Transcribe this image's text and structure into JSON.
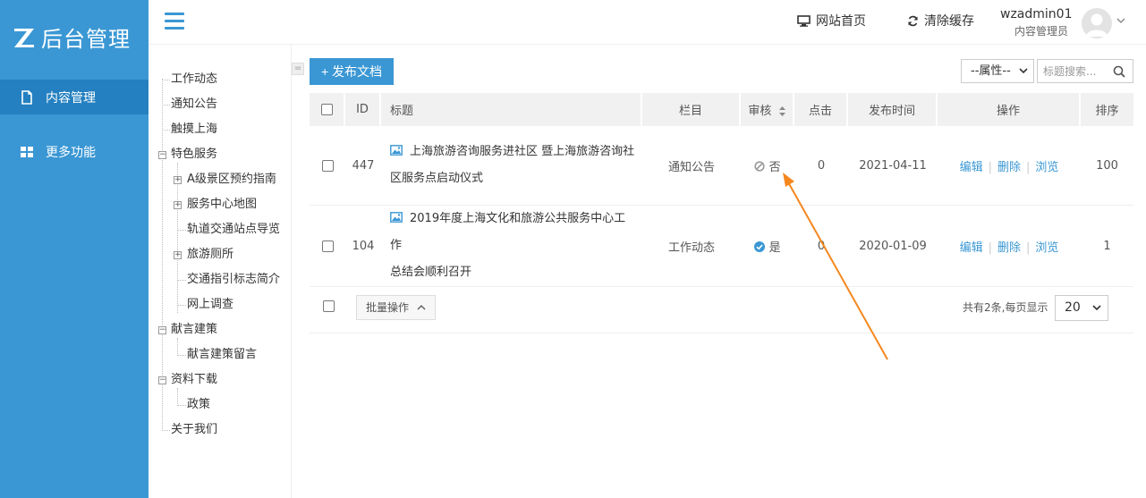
{
  "brand": {
    "logo_text": "后台管理"
  },
  "sidebar": {
    "items": [
      {
        "label": "内容管理",
        "icon": "document-icon",
        "active": true
      },
      {
        "label": "更多功能",
        "icon": "grid-icon",
        "active": false
      }
    ]
  },
  "header": {
    "home_label": "网站首页",
    "clear_cache_label": "清除缓存",
    "user_name": "wzadmin01",
    "user_role": "内容管理员"
  },
  "tree": {
    "n1": "工作动态",
    "n2": "通知公告",
    "n3": "触摸上海",
    "n4": "特色服务",
    "n4_1": "A级景区预约指南",
    "n4_2": "服务中心地图",
    "n4_3": "轨道交通站点导览",
    "n4_4": "旅游厕所",
    "n4_5": "交通指引标志简介",
    "n4_6": "网上调查",
    "n5": "献言建策",
    "n5_1": "献言建策留言",
    "n6": "资料下载",
    "n6_1": "政策",
    "n7": "关于我们"
  },
  "toolbar": {
    "publish_label": "+ 发布文档",
    "attribute_select": "--属性--",
    "search_placeholder": "标题搜索..."
  },
  "table": {
    "headers": {
      "id": "ID",
      "title": "标题",
      "column": "栏目",
      "audit": "审核",
      "clicks": "点击",
      "publish_time": "发布时间",
      "actions": "操作",
      "order": "排序"
    },
    "rows": [
      {
        "id": "447",
        "title_line1": "上海旅游咨询服务进社区 暨上海旅游咨询社",
        "title_line2": "区服务点启动仪式",
        "column": "通知公告",
        "audit": "否",
        "clicks": "0",
        "publish_time": "2021-04-11",
        "edit": "编辑",
        "delete": "删除",
        "view": "浏览",
        "order": "100"
      },
      {
        "id": "104",
        "title_line1": "2019年度上海文化和旅游公共服务中心工作",
        "title_line2": "总结会顺利召开",
        "column": "工作动态",
        "audit": "是",
        "clicks": "0",
        "publish_time": "2020-01-09",
        "edit": "编辑",
        "delete": "删除",
        "view": "浏览",
        "order": "1"
      }
    ]
  },
  "footer": {
    "batch_label": "批量操作",
    "total_text": "共有2条,每页显示",
    "page_size": "20"
  },
  "colors": {
    "sidebar_bg": "#3a97d4",
    "sidebar_active": "#2480c0",
    "link": "#3a97d4",
    "annotation_arrow": "#f5871f"
  }
}
